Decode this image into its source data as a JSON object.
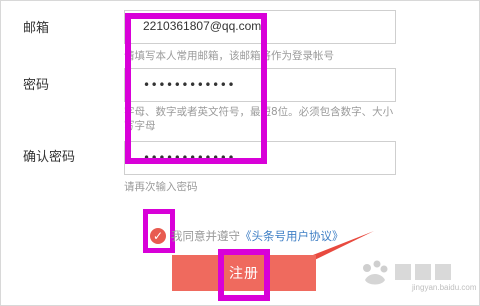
{
  "form": {
    "email": {
      "label": "邮箱",
      "value": "2210361807@qq.com",
      "hint": "请填写本人常用邮箱，该邮箱将作为登录帐号"
    },
    "password": {
      "label": "密码",
      "value": "••••••••••••",
      "hint": "字母、数字或者英文符号，最短8位。必须包含数字、大小写字母"
    },
    "confirm_password": {
      "label": "确认密码",
      "value": "••••••••••••",
      "hint": "请再次输入密码"
    },
    "agreement": {
      "prefix": "我同意并遵守",
      "link_text": "《头条号用户协议》",
      "checked": true
    },
    "submit_label": "注册"
  },
  "overlay": {
    "watermark": "jingyan.baidu.com",
    "highlight_color": "#d800d8",
    "arrow_color": "#e84a3f",
    "button_color": "#ef6a5e"
  },
  "icons": {
    "checkbox": "check-circle-icon",
    "arrow": "red-arrow-icon"
  }
}
